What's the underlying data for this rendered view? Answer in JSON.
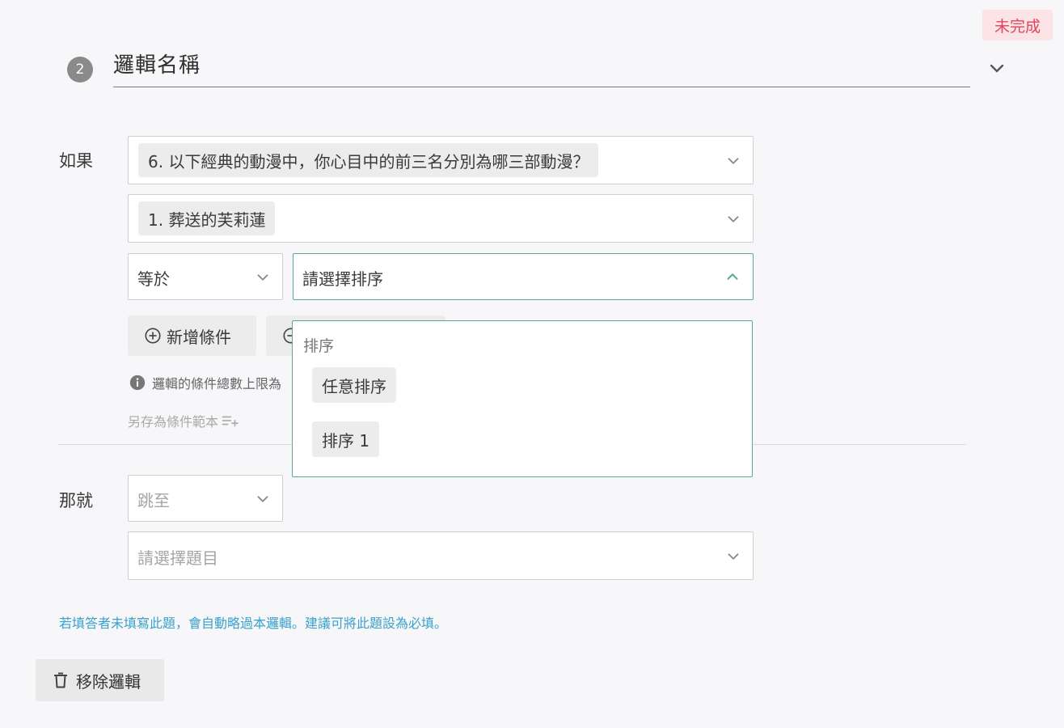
{
  "status": {
    "label": "未完成",
    "color": "#e0455a"
  },
  "header": {
    "step_number": "2",
    "logic_name": "邏輯名稱"
  },
  "if_section": {
    "label": "如果",
    "question_select": {
      "value": "6. 以下經典的動漫中，你心目中的前三名分別為哪三部動漫？"
    },
    "option_select": {
      "value": "1. 葬送的芙莉蓮"
    },
    "operator_select": {
      "value": "等於"
    },
    "rank_select": {
      "placeholder": "請選擇排序"
    },
    "add_condition_label": "新增條件",
    "info_text": "邏輯的條件總數上限為",
    "save_template_label": "另存為條件範本"
  },
  "rank_dropdown": {
    "group_label": "排序",
    "options": [
      "任意排序",
      "排序 1"
    ]
  },
  "then_section": {
    "label": "那就",
    "action_select": {
      "placeholder": "跳至"
    },
    "target_select": {
      "placeholder": "請選擇題目"
    }
  },
  "hint": "若填答者未填寫此題，會自動略過本邏輯。建議可將此題設為必填。",
  "remove_button_label": "移除邏輯",
  "colors": {
    "accent": "#5ca895",
    "hint": "#3aa2cc",
    "badge_bg": "#fbe3e6"
  }
}
